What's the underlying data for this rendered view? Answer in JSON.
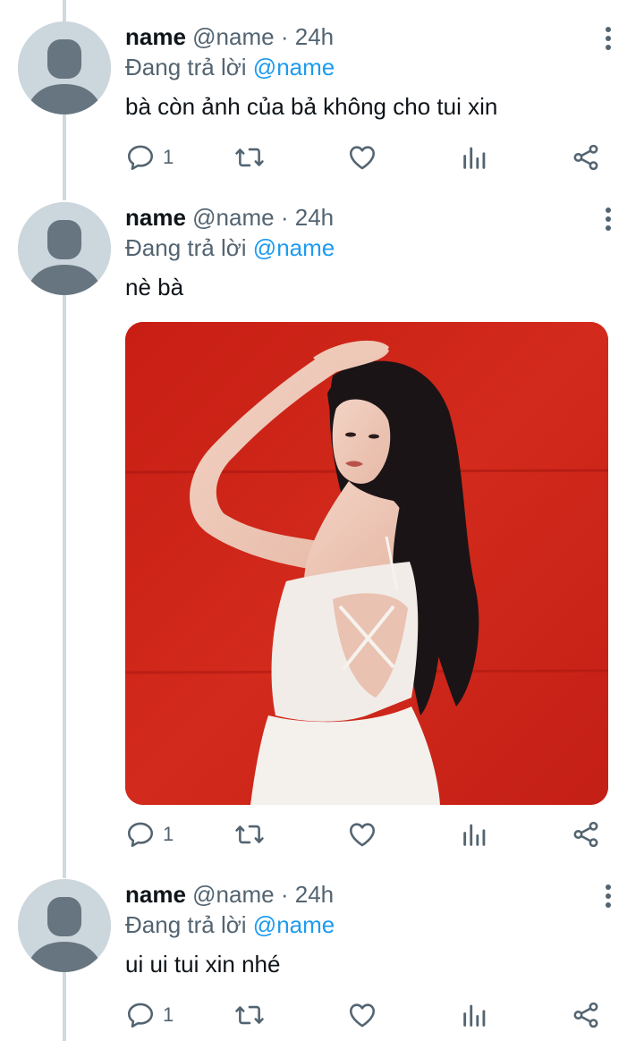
{
  "tweets": [
    {
      "display_name": "name",
      "handle": "@name",
      "separator": "·",
      "time": "24h",
      "replying_prefix": "Đang trả lời",
      "replying_to": "@name",
      "text": "bà còn ảnh của bả không cho tui xin",
      "reply_count": "1"
    },
    {
      "display_name": "name",
      "handle": "@name",
      "separator": "·",
      "time": "24h",
      "replying_prefix": "Đang trả lời",
      "replying_to": "@name",
      "text": "nè bà",
      "reply_count": "1",
      "has_media": true
    },
    {
      "display_name": "name",
      "handle": "@name",
      "separator": "·",
      "time": "24h",
      "replying_prefix": "Đang trả lời",
      "replying_to": "@name",
      "text": "ui ui tui xin nhé",
      "reply_count": "1"
    }
  ],
  "icons": {
    "reply": "reply-icon",
    "retweet": "retweet-icon",
    "like": "heart-icon",
    "views": "analytics-icon",
    "share": "share-icon",
    "more": "more-icon"
  },
  "colors": {
    "mention": "#1d9bf0",
    "secondary_text": "#536471",
    "primary_text": "#0f1419",
    "thread_line": "#cfd9de",
    "avatar_bg": "#ccd6dd",
    "media_bg": "#cc2218"
  }
}
